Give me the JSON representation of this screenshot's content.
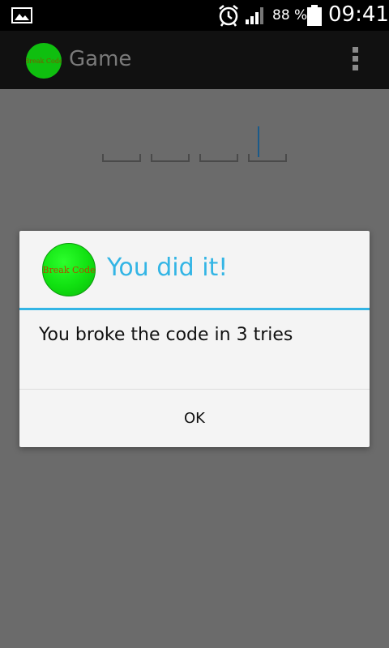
{
  "status_bar": {
    "battery_percent": "88 %",
    "time": "09:41",
    "icons": [
      "gallery-icon",
      "alarm-icon",
      "signal-icon",
      "battery-icon"
    ]
  },
  "action_bar": {
    "logo_text": "Break Code",
    "title": "Game",
    "menu_icon": "overflow-menu-icon"
  },
  "code_fields": [
    "",
    "",
    "",
    ""
  ],
  "dialog": {
    "icon_text": "Break Code",
    "title": "You did it!",
    "message": "You broke the code in 3 tries",
    "ok_label": "OK"
  },
  "colors": {
    "accent": "#33b5e5",
    "logo_green": "#10e010",
    "scrim": "#6b6b6b"
  }
}
